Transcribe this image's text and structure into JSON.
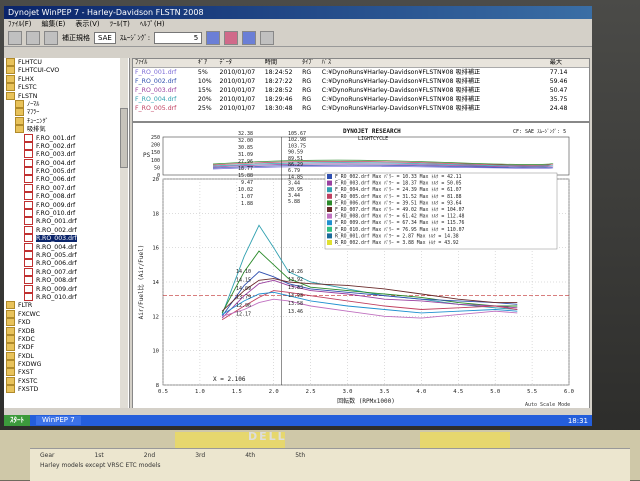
{
  "window": {
    "title": "Dynojet WinPEP 7 - Harley-Davidson FLSTN 2008",
    "menu": [
      "ﾌｧｲﾙ(F)",
      "編集(E)",
      "表示(V)",
      "ﾂｰﾙ(T)",
      "ﾍﾙﾌﾟ(H)"
    ]
  },
  "toolbar": {
    "correction_label": "補正規格",
    "correction_value": "SAE",
    "smoothing_label": "ｽﾑｰｼﾞﾝｸﾞ:",
    "smoothing_value": "5"
  },
  "tree": {
    "items": [
      {
        "label": "FLHTCU",
        "type": "folder",
        "level": 0
      },
      {
        "label": "FLHTCUI-CVO",
        "type": "folder",
        "level": 0
      },
      {
        "label": "FLHX",
        "type": "folder",
        "level": 0
      },
      {
        "label": "FLSTC",
        "type": "folder",
        "level": 0
      },
      {
        "label": "FLSTN",
        "type": "folder",
        "level": 0
      },
      {
        "label": "ﾉｰﾏﾙ",
        "type": "folder",
        "level": 1
      },
      {
        "label": "ﾏﾌﾗｰ",
        "type": "folder",
        "level": 1
      },
      {
        "label": "ﾁｭｰﾆﾝｸﾞ",
        "type": "folder",
        "level": 1
      },
      {
        "label": "吸排気",
        "type": "folder",
        "level": 1
      },
      {
        "label": "F.RO_001.drf",
        "type": "file",
        "level": 2
      },
      {
        "label": "F.RO_002.drf",
        "type": "file",
        "level": 2
      },
      {
        "label": "F.RO_003.drf",
        "type": "file",
        "level": 2
      },
      {
        "label": "F.RO_004.drf",
        "type": "file",
        "level": 2
      },
      {
        "label": "F.RO_005.drf",
        "type": "file",
        "level": 2
      },
      {
        "label": "F.RO_006.drf",
        "type": "file",
        "level": 2
      },
      {
        "label": "F.RO_007.drf",
        "type": "file",
        "level": 2
      },
      {
        "label": "F.RO_008.drf",
        "type": "file",
        "level": 2
      },
      {
        "label": "F.RO_009.drf",
        "type": "file",
        "level": 2
      },
      {
        "label": "F.RO_010.drf",
        "type": "file",
        "level": 2
      },
      {
        "label": "R.RO_001.drf",
        "type": "file",
        "level": 2
      },
      {
        "label": "R.RO_002.drf",
        "type": "file",
        "level": 2
      },
      {
        "label": "R.RO_003.drf",
        "type": "file",
        "level": 2,
        "selected": true
      },
      {
        "label": "R.RO_004.drf",
        "type": "file",
        "level": 2
      },
      {
        "label": "R.RO_005.drf",
        "type": "file",
        "level": 2
      },
      {
        "label": "R.RO_006.drf",
        "type": "file",
        "level": 2
      },
      {
        "label": "R.RO_007.drf",
        "type": "file",
        "level": 2
      },
      {
        "label": "R.RO_008.drf",
        "type": "file",
        "level": 2
      },
      {
        "label": "R.RO_009.drf",
        "type": "file",
        "level": 2
      },
      {
        "label": "R.RO_010.drf",
        "type": "file",
        "level": 2
      },
      {
        "label": "FLTR",
        "type": "folder",
        "level": 0
      },
      {
        "label": "FXCWC",
        "type": "folder",
        "level": 0
      },
      {
        "label": "FXD",
        "type": "folder",
        "level": 0
      },
      {
        "label": "FXDB",
        "type": "folder",
        "level": 0
      },
      {
        "label": "FXDC",
        "type": "folder",
        "level": 0
      },
      {
        "label": "FXDF",
        "type": "folder",
        "level": 0
      },
      {
        "label": "FXDL",
        "type": "folder",
        "level": 0
      },
      {
        "label": "FXDWG",
        "type": "folder",
        "level": 0
      },
      {
        "label": "FXST",
        "type": "folder",
        "level": 0
      },
      {
        "label": "FXSTC",
        "type": "folder",
        "level": 0
      },
      {
        "label": "FXSTD",
        "type": "folder",
        "level": 0
      }
    ]
  },
  "runs_table": {
    "headers": [
      "ﾌｧｲﾙ",
      "ｷﾞｱ",
      "ﾃﾞｰﾀ",
      "時間",
      "ﾀｲﾌﾟ",
      "ﾊﾟｽ",
      "最大"
    ],
    "rows": [
      {
        "file": "F_RO_001.drf",
        "gear": "5%",
        "date": "2010/01/07",
        "time": "18:24:52",
        "type": "RG",
        "path": "C:¥DynoRuns¥Harley-Davidson¥FLSTN¥08 吸排補正",
        "max": "77.14",
        "color": "#7a6ad6"
      },
      {
        "file": "F_RO_002.drf",
        "gear": "10%",
        "date": "2010/01/07",
        "time": "18:27:22",
        "type": "RG",
        "path": "C:¥DynoRuns¥Harley-Davidson¥FLSTN¥08 吸排補正",
        "max": "59.46",
        "color": "#3050b0"
      },
      {
        "file": "F_RO_003.drf",
        "gear": "15%",
        "date": "2010/01/07",
        "time": "18:28:52",
        "type": "RG",
        "path": "C:¥DynoRuns¥Harley-Davidson¥FLSTN¥08 吸排補正",
        "max": "50.47",
        "color": "#9a40a0"
      },
      {
        "file": "F_RO_004.drf",
        "gear": "20%",
        "date": "2010/01/07",
        "time": "18:29:46",
        "type": "RG",
        "path": "C:¥DynoRuns¥Harley-Davidson¥FLSTN¥08 吸排補正",
        "max": "35.75",
        "color": "#30a0b0"
      },
      {
        "file": "F_RO_005.drf",
        "gear": "25%",
        "date": "2010/01/07",
        "time": "18:30:48",
        "type": "RG",
        "path": "C:¥DynoRuns¥Harley-Davidson¥FLSTN¥08 吸排補正",
        "max": "24.48",
        "color": "#c04060"
      }
    ]
  },
  "chart": {
    "header_left": "DYNOJET RESEARCH",
    "header_sub": "LIGHTCYCLE",
    "header_right": "CF: SAE   ｽﾑｰｼﾞﾝｸﾞ: 5",
    "cursor_value": "X = 2.106",
    "xlabel": "回転数 (RPMx1000)",
    "ylabel": "Air/Fuel比 (Air/Fuel)",
    "top_ylabel": "PS",
    "left_readouts": [
      "32.38",
      "32.00",
      "30.85",
      "31.09",
      "27.96",
      "18.77",
      "15.88",
      "9.47",
      "10.02",
      "1.07",
      "1.88"
    ],
    "right_readouts": [
      "105.67",
      "102.98",
      "103.75",
      "90.59",
      "89.51",
      "86.29",
      "6.79",
      "14.85",
      "3.44",
      "20.95",
      "3.44",
      "5.88"
    ],
    "afr_left_readouts": [
      "14.10",
      "14.15",
      "14.09",
      "13.79",
      "12.96",
      "12.17"
    ],
    "afr_right_readouts": [
      "14.26",
      "13.92",
      "13.83",
      "13.98",
      "13.58",
      "13.46"
    ],
    "legend": [
      {
        "label": "F_RO_002.drf Max ﾊﾟﾜｰ = 10.33  Max ﾄﾙｸ = 42.11",
        "color": "#3050b0"
      },
      {
        "label": "F_RO_003.drf Max ﾊﾟﾜｰ = 18.37  Max ﾄﾙｸ = 50.05",
        "color": "#9a40a0"
      },
      {
        "label": "F_RO_004.drf Max ﾊﾟﾜｰ = 24.39  Max ﾄﾙｸ = 61.07",
        "color": "#30a0b0"
      },
      {
        "label": "F_RO_005.drf Max ﾊﾟﾜｰ = 31.52  Max ﾄﾙｸ = 81.88",
        "color": "#c04060"
      },
      {
        "label": "F_RO_006.drf Max ﾊﾟﾜｰ = 39.51  Max ﾄﾙｸ = 93.64",
        "color": "#2a8a2a"
      },
      {
        "label": "F_RO_007.drf Max ﾊﾟﾜｰ = 49.02  Max ﾄﾙｸ = 104.07",
        "color": "#6a2a2a"
      },
      {
        "label": "F_RO_008.drf Max ﾊﾟﾜｰ = 61.42  Max ﾄﾙｸ = 112.48",
        "color": "#c070c0"
      },
      {
        "label": "F_RO_009.drf Max ﾊﾟﾜｰ = 67.34  Max ﾄﾙｸ = 115.76",
        "color": "#2090d0"
      },
      {
        "label": "F_RO_010.drf Max ﾊﾟﾜｰ = 76.95  Max ﾄﾙｸ = 110.07",
        "color": "#30c080"
      },
      {
        "label": "R_RO_001.drf Max ﾊﾟﾜｰ = 2.87   Max ﾄﾙｸ = 14.38",
        "color": "#1a6a9a"
      },
      {
        "label": "R_RO_002.drf Max ﾊﾟﾜｰ = 3.88   Max ﾄﾙｸ = 43.92",
        "color": "#e0e030"
      }
    ],
    "status_text": "Auto Scale Mode"
  },
  "taskbar": {
    "start": "ｽﾀｰﾄ",
    "task": "WinPEP 7",
    "clock": "18:31"
  },
  "desk": {
    "brand": "DELL",
    "paper_row1": [
      "Gear",
      "1st",
      "2nd",
      "3rd",
      "4th",
      "5th"
    ],
    "paper_note": "Harley models except VRSC    ETC models"
  },
  "chart_data": {
    "type": "line",
    "xlabel": "回転数 (RPMx1000)",
    "ylabel": "Air/Fuel比 (Air/Fuel)",
    "xlim": [
      0.5,
      6.0
    ],
    "ylim": [
      8,
      20
    ],
    "xticks": [
      "0.5",
      "1.0",
      "1.5",
      "2.0",
      "2.5",
      "3.0",
      "3.5",
      "4.0",
      "4.5",
      "5.0",
      "5.5",
      "6.0"
    ],
    "yticks": [
      "8",
      "10",
      "12",
      "14",
      "16",
      "18",
      "20"
    ],
    "top_ylim": [
      0,
      250
    ],
    "top_yticks": [
      "0",
      "50",
      "100",
      "150",
      "200",
      "250"
    ],
    "reference_y": 13.2,
    "cursor_x": 2.106,
    "series": [
      {
        "color": "#30a0b0",
        "x": [
          1.3,
          1.6,
          1.8,
          2.0,
          2.2,
          2.5,
          3.0,
          3.5,
          4.0,
          4.5,
          5.0,
          5.3
        ],
        "y": [
          12.1,
          15.5,
          17.3,
          16.0,
          14.6,
          14.0,
          13.6,
          13.2,
          13.0,
          12.7,
          12.5,
          12.4
        ]
      },
      {
        "color": "#2a8a2a",
        "x": [
          1.3,
          1.6,
          1.8,
          2.0,
          2.2,
          2.5,
          3.0,
          3.5,
          4.0,
          4.5,
          5.0,
          5.3
        ],
        "y": [
          12.2,
          14.6,
          15.8,
          15.0,
          14.2,
          13.7,
          13.5,
          13.3,
          13.1,
          12.8,
          12.6,
          12.6
        ]
      },
      {
        "color": "#3050b0",
        "x": [
          1.3,
          1.6,
          1.8,
          2.0,
          2.2,
          2.5,
          3.0,
          3.5,
          4.0,
          4.5,
          5.0,
          5.3
        ],
        "y": [
          12.0,
          13.8,
          14.6,
          14.3,
          13.9,
          13.6,
          13.4,
          13.2,
          13.0,
          12.9,
          12.8,
          12.7
        ]
      },
      {
        "color": "#9a40a0",
        "x": [
          1.3,
          1.6,
          1.8,
          2.0,
          2.2,
          2.5,
          3.0,
          3.5,
          4.0,
          4.5,
          5.0,
          5.3
        ],
        "y": [
          11.9,
          13.2,
          13.9,
          14.1,
          13.8,
          13.5,
          13.3,
          13.0,
          12.9,
          12.7,
          12.6,
          12.5
        ]
      },
      {
        "color": "#c04060",
        "x": [
          1.3,
          1.6,
          1.8,
          2.0,
          2.2,
          2.5,
          3.0,
          3.5,
          4.0,
          4.5,
          5.0,
          5.3
        ],
        "y": [
          11.8,
          12.6,
          13.1,
          13.5,
          13.4,
          13.2,
          12.9,
          12.6,
          12.4,
          12.5,
          12.6,
          12.4
        ]
      },
      {
        "color": "#6a2a2a",
        "x": [
          1.3,
          1.6,
          1.8,
          2.0,
          2.2,
          2.5,
          3.0,
          3.5,
          4.0,
          4.5,
          5.0,
          5.3
        ],
        "y": [
          12.3,
          13.5,
          14.1,
          14.2,
          14.0,
          13.9,
          13.8,
          13.6,
          13.3,
          13.0,
          12.8,
          12.8
        ]
      },
      {
        "color": "#c070c0",
        "x": [
          1.3,
          1.6,
          1.8,
          2.0,
          2.2,
          2.5,
          3.0,
          3.5,
          4.0,
          4.5,
          5.0,
          5.3
        ],
        "y": [
          12.0,
          12.4,
          12.8,
          13.0,
          12.9,
          12.6,
          12.3,
          12.0,
          11.9,
          12.1,
          12.3,
          12.2
        ]
      },
      {
        "color": "#2090d0",
        "x": [
          1.3,
          1.6,
          1.8,
          2.0,
          2.2,
          2.5,
          3.0,
          3.5,
          4.0,
          4.5,
          5.0,
          5.3
        ],
        "y": [
          12.1,
          12.9,
          13.3,
          13.4,
          13.2,
          12.9,
          12.6,
          12.4,
          12.2,
          12.3,
          12.4,
          12.3
        ]
      }
    ]
  }
}
